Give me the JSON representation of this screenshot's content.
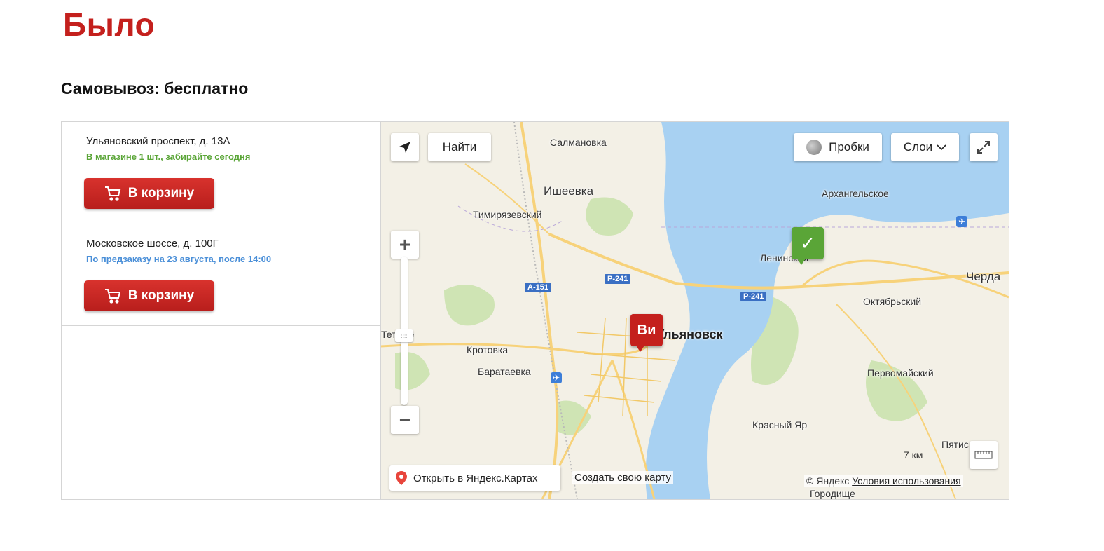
{
  "page": {
    "title": "Было"
  },
  "pickup": {
    "heading": "Самовывоз: бесплатно"
  },
  "stores": [
    {
      "address": "Ульяновский проспект, д. 13А",
      "status": "В магазине 1 шт., забирайте сегодня",
      "cart_label": "В корзину"
    },
    {
      "address": "Московское шоссе, д. 100Г",
      "status": "По предзаказу на 23 августа, после 14:00",
      "cart_label": "В корзину"
    }
  ],
  "map": {
    "find_label": "Найти",
    "traffic_label": "Пробки",
    "layers_label": "Слои",
    "zoom_in": "+",
    "zoom_out": "−",
    "open_in_yandex": "Открыть в Яндекс.Картах",
    "create_map": "Создать свою карту",
    "scale": "7 км",
    "copyright": "© Яндекс",
    "terms": "Условия использования",
    "marker_vi": "Ви",
    "places": {
      "salmanovka": "Салмановка",
      "isheevka": "Ишеевка",
      "timiryazevsky": "Тимирязевский",
      "arkhangelskoe": "Архангельское",
      "leninsky": "Ленинский",
      "cherdaklы": "Черда",
      "oktyabrsky": "Октябрьский",
      "ulyanovsk": "Ульяновск",
      "kortovka": "Кротовка",
      "barataevka": "Баратаевка",
      "pervomaysky": "Первомайский",
      "krasny_yar": "Красный Яр",
      "pyatis": "Пятис",
      "gorodishe": "Городище",
      "tetyushskoe": "Тет   кое"
    },
    "roads": {
      "a151": "А-151",
      "r241_a": "Р-241",
      "r241_b": "Р-241"
    },
    "colors": {
      "water": "#a8d1f2",
      "land": "#f3f0e6",
      "forest": "#cfe4b4",
      "road": "#f7d27a"
    }
  },
  "colors": {
    "brand_red": "#c4201d",
    "status_green": "#5aa537",
    "status_blue": "#4a8fd8"
  }
}
